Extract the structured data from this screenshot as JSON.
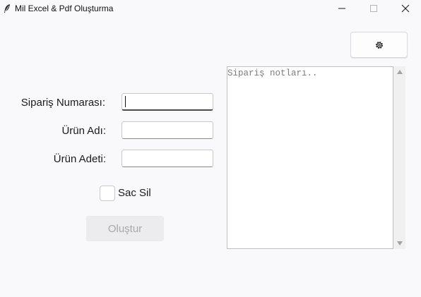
{
  "window": {
    "title": "Mil Excel & Pdf Oluşturma",
    "icon": "feather-icon",
    "controls": [
      "minimize-icon",
      "maximize-icon",
      "close-icon"
    ]
  },
  "toolbar": {
    "settings_icon": "gear-icon"
  },
  "form": {
    "order_number_label": "Sipariş Numarası:",
    "order_number_value": "",
    "product_name_label": "Ürün Adı:",
    "product_name_value": "",
    "product_qty_label": "Ürün Adeti:",
    "product_qty_value": "",
    "checkbox_label": "Sac Sil",
    "checkbox_checked": false,
    "create_button_label": "Oluştur",
    "create_button_enabled": false
  },
  "notes": {
    "placeholder": "Sipariş notları.."
  }
}
